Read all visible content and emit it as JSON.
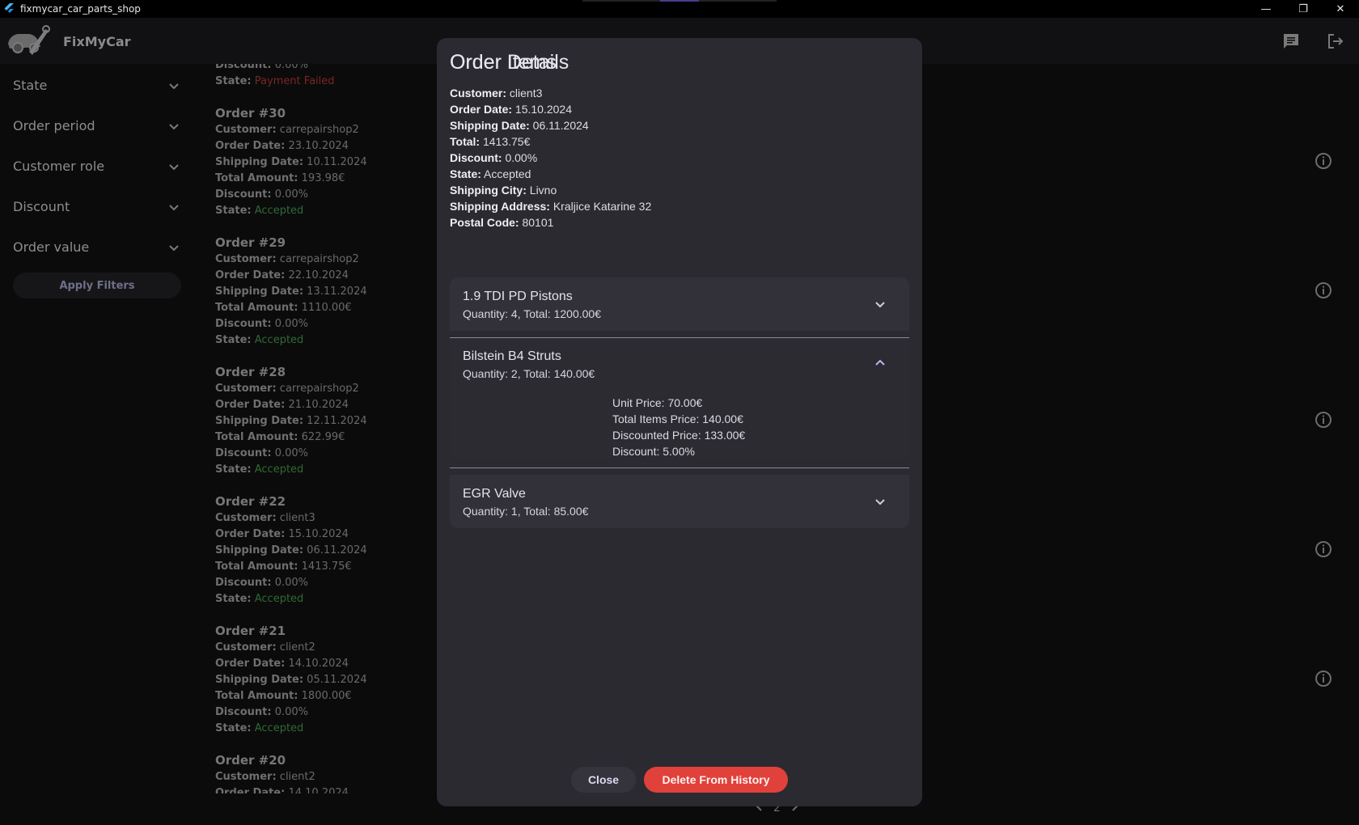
{
  "window": {
    "title": "fixmycar_car_parts_shop",
    "controls": [
      "—",
      "❐",
      "✕"
    ]
  },
  "header": {
    "brand": "FixMyCar",
    "icons": [
      "chat-icon",
      "logout-icon"
    ]
  },
  "sidebar": {
    "filters": [
      {
        "label": "State"
      },
      {
        "label": "Order period"
      },
      {
        "label": "Customer role"
      },
      {
        "label": "Discount"
      },
      {
        "label": "Order value"
      }
    ],
    "apply_label": "Apply Filters"
  },
  "orders": {
    "partial_top": {
      "discount_label": "Discount:",
      "discount": "0.00%",
      "state_label": "State:",
      "state": "Payment Failed"
    },
    "list": [
      {
        "title": "Order #30",
        "customer": "carrepairshop2",
        "order_date": "23.10.2024",
        "shipping_date": "10.11.2024",
        "total": "193.98€",
        "discount": "0.00%",
        "state": "Accepted"
      },
      {
        "title": "Order #29",
        "customer": "carrepairshop2",
        "order_date": "22.10.2024",
        "shipping_date": "13.11.2024",
        "total": "1110.00€",
        "discount": "0.00%",
        "state": "Accepted"
      },
      {
        "title": "Order #28",
        "customer": "carrepairshop2",
        "order_date": "21.10.2024",
        "shipping_date": "12.11.2024",
        "total": "622.99€",
        "discount": "0.00%",
        "state": "Accepted"
      },
      {
        "title": "Order #22",
        "customer": "client3",
        "order_date": "15.10.2024",
        "shipping_date": "06.11.2024",
        "total": "1413.75€",
        "discount": "0.00%",
        "state": "Accepted"
      },
      {
        "title": "Order #21",
        "customer": "client2",
        "order_date": "14.10.2024",
        "shipping_date": "05.11.2024",
        "total": "1800.00€",
        "discount": "0.00%",
        "state": "Accepted"
      }
    ],
    "partial_bottom": {
      "title": "Order #20",
      "customer": "client2",
      "order_date": "14.10.2024"
    },
    "labels": {
      "customer": "Customer:",
      "order_date": "Order Date:",
      "shipping_date": "Shipping Date:",
      "total": "Total Amount:",
      "discount": "Discount:",
      "state": "State:"
    }
  },
  "pagination": {
    "page": "2"
  },
  "modal": {
    "title": "Order Details",
    "details": [
      {
        "label": "Customer:",
        "value": "client3"
      },
      {
        "label": "Order Date:",
        "value": "15.10.2024"
      },
      {
        "label": "Shipping Date:",
        "value": "06.11.2024"
      },
      {
        "label": "Total:",
        "value": "1413.75€"
      },
      {
        "label": "Discount:",
        "value": "0.00%"
      },
      {
        "label": "State:",
        "value": "Accepted"
      },
      {
        "label": "Shipping City:",
        "value": "Livno"
      },
      {
        "label": "Shipping Address:",
        "value": "Kraljice Katarine 32"
      },
      {
        "label": "Postal Code:",
        "value": "80101"
      }
    ],
    "items_title": "Order Items",
    "items": [
      {
        "name": "1.9 TDI PD Pistons",
        "summary": "Quantity: 4, Total: 1200.00€",
        "expanded": false
      },
      {
        "name": "Bilstein B4 Struts",
        "summary": "Quantity: 2, Total: 140.00€",
        "expanded": true
      },
      {
        "name": "EGR Valve",
        "summary": "Quantity: 1, Total: 85.00€",
        "expanded": false
      }
    ],
    "expanded_details": {
      "unit_price": "Unit Price: 70.00€",
      "total_items_price": "Total Items Price: 140.00€",
      "discounted_price": "Discounted Price: 133.00€",
      "discount": "Discount: 5.00%"
    },
    "close_label": "Close",
    "delete_label": "Delete From History"
  },
  "colors": {
    "accepted": "#2f6a34",
    "payment_failed": "#7a2624",
    "delete_button": "#e0413a",
    "modal_bg": "#2b2a31"
  }
}
